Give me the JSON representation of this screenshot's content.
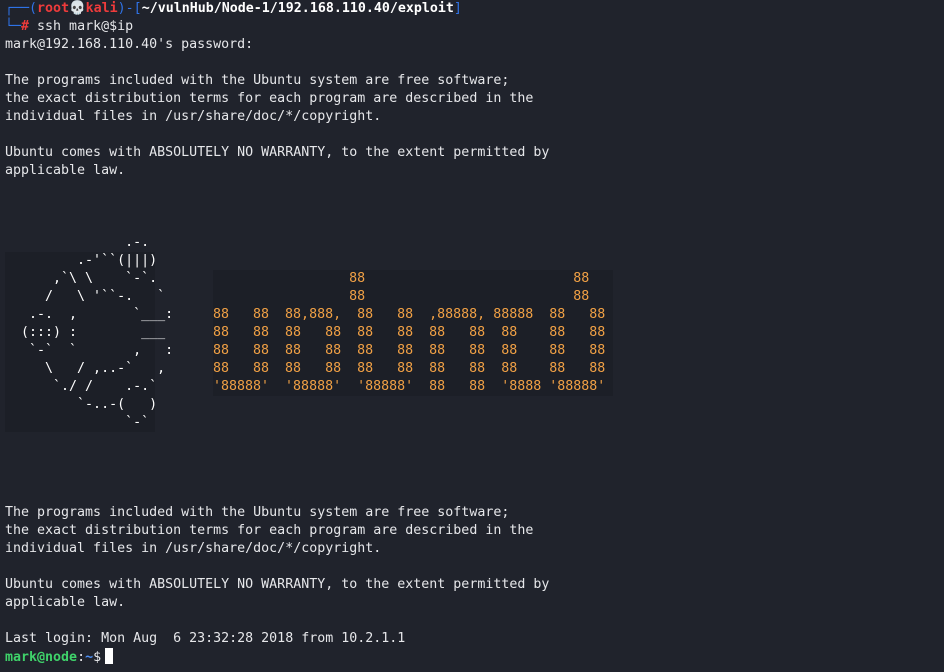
{
  "prompt": {
    "corner_top": "┌──",
    "open_paren": "(",
    "user": "root",
    "skull": "💀",
    "host": "kali",
    "close_paren": ")-[",
    "path": "~/vulnHub/Node-1/192.168.110.40/exploit",
    "close_bracket": "]",
    "corner_bottom": "└─",
    "hash": "#",
    "command": " ssh mark@$ip"
  },
  "password_prompt": "mark@192.168.110.40's password:",
  "motd1": [
    "The programs included with the Ubuntu system are free software;",
    "the exact distribution terms for each program are described in the",
    "individual files in /usr/share/doc/*/copyright.",
    "",
    "Ubuntu comes with ABSOLUTELY NO WARRANTY, to the extent permitted by",
    "applicable law."
  ],
  "logo_lines": [
    "               .-.",
    "         .-'``(|||)",
    "      ,`\\ \\    `-`.",
    "     /   \\ '``-.   `",
    "   .-.  ,       `___:",
    "  (:::) :        ___",
    "   `-`  `       ,   :",
    "     \\   / ,..-`   ,",
    "      `./ /    .-.`",
    "         `-..-(   )",
    "               `-`"
  ],
  "banner_lines": [
    "                 88                          88",
    "                 88                          88",
    "88   88  88,888,  88   88  ,88888, 88888  88   88",
    "88   88  88   88  88   88  88   88  88    88   88",
    "88   88  88   88  88   88  88   88  88    88   88",
    "88   88  88   88  88   88  88   88  88    88   88",
    "'88888'  '88888'  '88888'  88   88  '8888 '88888'"
  ],
  "motd2": [
    "The programs included with the Ubuntu system are free software;",
    "the exact distribution terms for each program are described in the",
    "individual files in /usr/share/doc/*/copyright.",
    "",
    "Ubuntu comes with ABSOLUTELY NO WARRANTY, to the extent permitted by",
    "applicable law."
  ],
  "last_login": "Last login: Mon Aug  6 23:32:28 2018 from 10.2.1.1",
  "shell_prompt": {
    "userhost": "mark@node",
    "sep": ":",
    "path": "~",
    "dollar": "$"
  }
}
